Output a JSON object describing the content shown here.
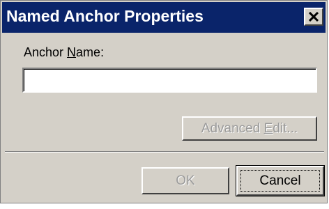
{
  "dialog": {
    "title": "Named Anchor Properties",
    "close_symbol": "X",
    "close_icon": "close-icon"
  },
  "form": {
    "anchor_name_label_prefix": "Anchor ",
    "anchor_name_label_accel": "N",
    "anchor_name_label_suffix": "ame:",
    "anchor_name_value": ""
  },
  "buttons": {
    "advanced_edit_prefix": "Advanced ",
    "advanced_edit_accel": "E",
    "advanced_edit_suffix": "dit...",
    "ok_label": "OK",
    "cancel_label": "Cancel"
  },
  "colors": {
    "titlebar": "#0a246a",
    "dialog_face": "#d4d0c8",
    "disabled_text": "#9a9a9a"
  }
}
